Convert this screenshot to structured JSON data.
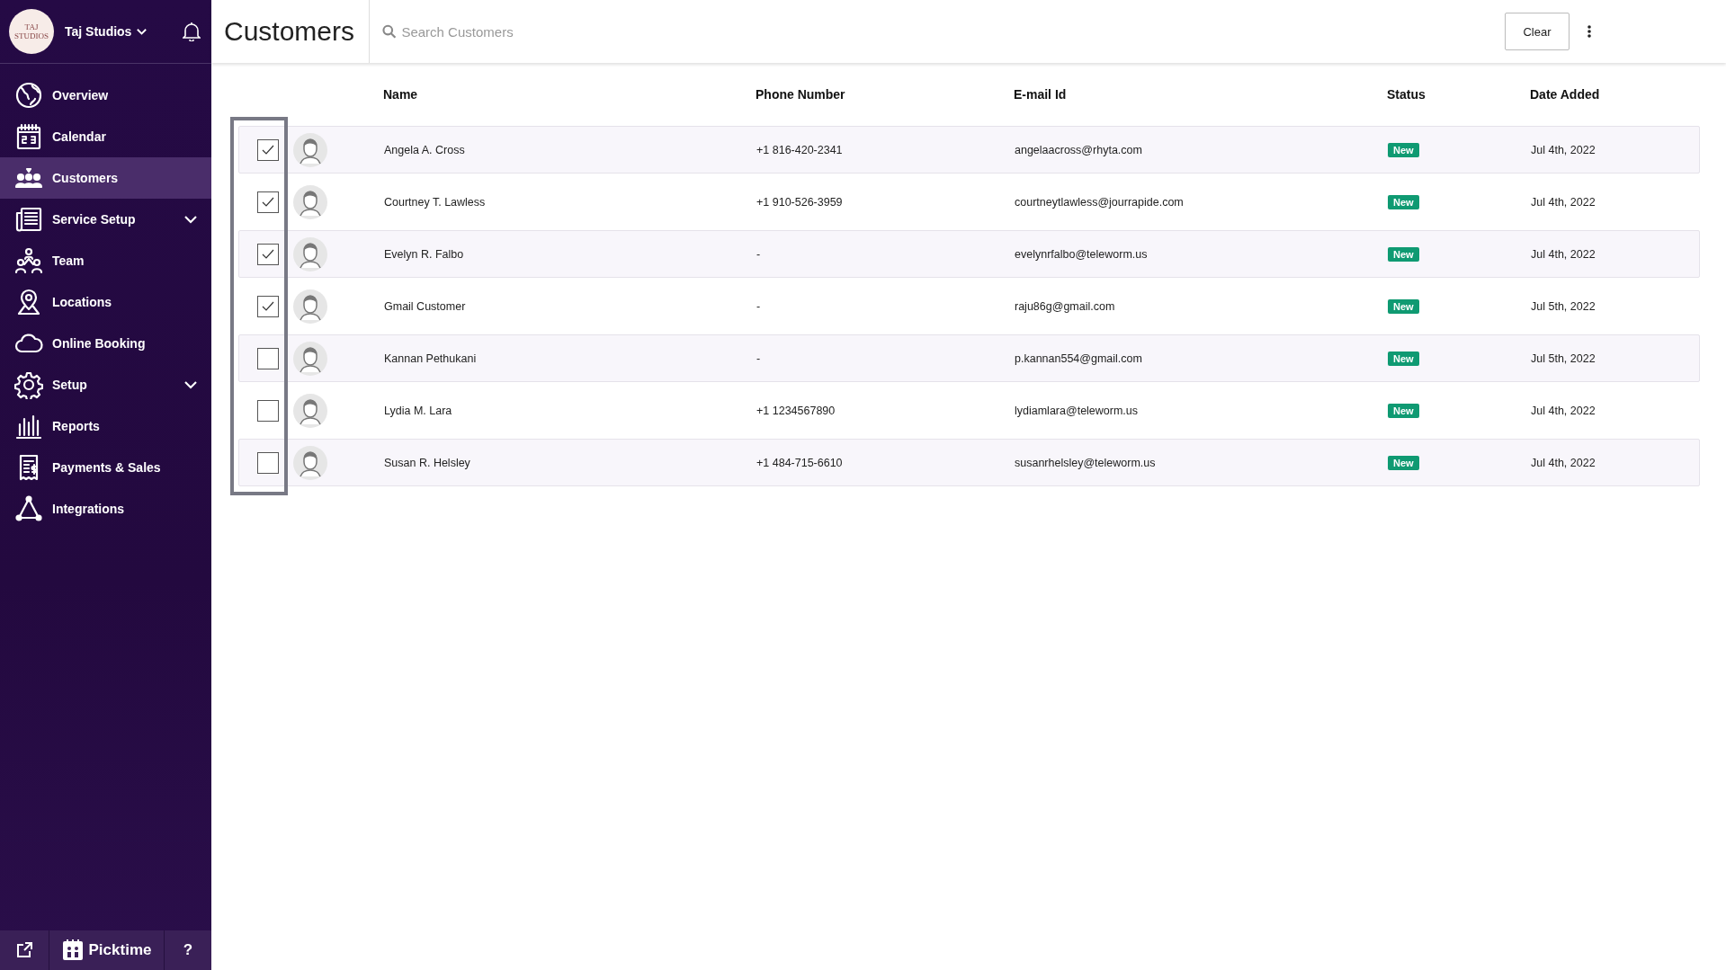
{
  "sidebar": {
    "logo_text": "TAJ STUDIOS",
    "account": "Taj Studios",
    "items": [
      {
        "label": "Overview",
        "selected": false,
        "has_submenu": false
      },
      {
        "label": "Calendar",
        "selected": false,
        "has_submenu": false
      },
      {
        "label": "Customers",
        "selected": true,
        "has_submenu": false
      },
      {
        "label": "Service Setup",
        "selected": false,
        "has_submenu": true
      },
      {
        "label": "Team",
        "selected": false,
        "has_submenu": false
      },
      {
        "label": "Locations",
        "selected": false,
        "has_submenu": false
      },
      {
        "label": "Online Booking",
        "selected": false,
        "has_submenu": false
      },
      {
        "label": "Setup",
        "selected": false,
        "has_submenu": true
      },
      {
        "label": "Reports",
        "selected": false,
        "has_submenu": false
      },
      {
        "label": "Payments & Sales",
        "selected": false,
        "has_submenu": false
      },
      {
        "label": "Integrations",
        "selected": false,
        "has_submenu": false
      }
    ],
    "footer": {
      "brand": "Picktime",
      "help": "?"
    }
  },
  "header": {
    "title": "Customers",
    "search": {
      "placeholder": "Search Customers"
    },
    "clear_button": "Clear"
  },
  "table": {
    "columns": [
      "Name",
      "Phone Number",
      "E-mail Id",
      "Status",
      "Date Added"
    ],
    "rows": [
      {
        "checked": true,
        "name": "Angela A. Cross",
        "phone": "+1 816-420-2341",
        "email": "angelaacross@rhyta.com",
        "status": "New",
        "date": "Jul 4th, 2022"
      },
      {
        "checked": true,
        "name": "Courtney T. Lawless",
        "phone": "+1 910-526-3959",
        "email": "courtneytlawless@jourrapide.com",
        "status": "New",
        "date": "Jul 4th, 2022"
      },
      {
        "checked": true,
        "name": "Evelyn R. Falbo",
        "phone": "-",
        "email": "evelynrfalbo@teleworm.us",
        "status": "New",
        "date": "Jul 4th, 2022"
      },
      {
        "checked": true,
        "name": "Gmail Customer",
        "phone": "-",
        "email": "raju86g@gmail.com",
        "status": "New",
        "date": "Jul 5th, 2022"
      },
      {
        "checked": false,
        "name": "Kannan Pethukani",
        "phone": "-",
        "email": "p.kannan554@gmail.com",
        "status": "New",
        "date": "Jul 5th, 2022"
      },
      {
        "checked": false,
        "name": "Lydia M. Lara",
        "phone": "+1 1234567890",
        "email": "lydiamlara@teleworm.us",
        "status": "New",
        "date": "Jul 4th, 2022"
      },
      {
        "checked": false,
        "name": "Susan R. Helsley",
        "phone": "+1 484-715-6610",
        "email": "susanrhelsley@teleworm.us",
        "status": "New",
        "date": "Jul 4th, 2022"
      }
    ]
  }
}
